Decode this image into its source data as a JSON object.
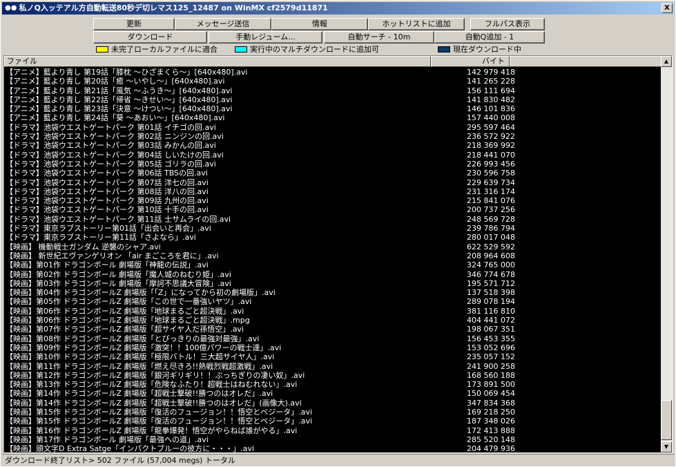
{
  "window": {
    "title": "私ノQ入ッテアル方自動転送80秒デ切レマス125_12487 on WinMX cf2579d11871",
    "close": "X"
  },
  "toolbar": {
    "row1": [
      "更新",
      "メッセージ送信",
      "情報",
      "ホットリストに追加",
      "フルパス表示"
    ],
    "row2": [
      "ダウンロード",
      "手動レジューム...",
      "自動サーチ - 10m",
      "自動Q追加 - 1"
    ]
  },
  "legend": [
    {
      "label": "未完了ローカルファイルに適合",
      "color": "#ffff00"
    },
    {
      "label": "実行中のマルチダウンロードに追加可",
      "color": "#00ffff"
    },
    {
      "label": "現在ダウンロード中",
      "color": "#0a3a6a"
    }
  ],
  "columns": {
    "file": "ファイル",
    "bytes": "バイト"
  },
  "files": [
    [
      "【アニメ】藍より青し 第19話「膝枕 ～ひざまくら～」[640x480].avi",
      "142 979 418"
    ],
    [
      "【アニメ】藍より青し 第20話「癒 ～いやし～」[640x480].avi",
      "141 265 228"
    ],
    [
      "【アニメ】藍より青し 第21話「風気 ～ふうき～」[640x480].avi",
      "156 111 694"
    ],
    [
      "【アニメ】藍より青し 第22話「帰省 ～きせい～」[640x480].avi",
      "141 830 482"
    ],
    [
      "【アニメ】藍より青し 第23話「決意 ～けつい～」[640x480].avi",
      "146 101 836"
    ],
    [
      "【アニメ】藍より青し 第24話「葵 ～あおい～」[640x480].avi",
      "157 440 008"
    ],
    [
      "【ドラマ】池袋ウエストゲートパーク 第01話 イチゴの回.avi",
      "295 597 464"
    ],
    [
      "【ドラマ】池袋ウエストゲートパーク 第02話 ニンジンの回.avi",
      "236 572 922"
    ],
    [
      "【ドラマ】池袋ウエストゲートパーク 第03話 みかんの回.avi",
      "218 369 992"
    ],
    [
      "【ドラマ】池袋ウエストゲートパーク 第04話 しいたけの回.avi",
      "218 441 070"
    ],
    [
      "【ドラマ】池袋ウエストゲートパーク 第05話 ゴリラの回.avi",
      "226 993 456"
    ],
    [
      "【ドラマ】池袋ウエストゲートパーク 第06話 TBSの回.avi",
      "230 596 758"
    ],
    [
      "【ドラマ】池袋ウエストゲートパーク 第07話 洋七の回.avi",
      "229 639 734"
    ],
    [
      "【ドラマ】池袋ウエストゲートパーク 第08話 洋八の回.avi",
      "231 316 174"
    ],
    [
      "【ドラマ】池袋ウエストゲートパーク 第09話 九州の回.avi",
      "215 841 076"
    ],
    [
      "【ドラマ】池袋ウエストゲートパーク 第10話 十手の回.avi",
      "200 737 256"
    ],
    [
      "【ドラマ】池袋ウエストゲートパーク 第11話 士サムライの回.avi",
      "248 569 728"
    ],
    [
      "【ドラマ】東京ラブストーリー第01話「出会いと再会」.avi",
      "239 786 794"
    ],
    [
      "【ドラマ】東京ラブストーリー第11話「さよなら」.avi",
      "280 017 048"
    ],
    [
      "【映画】 機動戦士ガンダム 逆襲のシャア.avi",
      "622 529 592"
    ],
    [
      "【映画】 新世紀エヴァンゲリオン 「air まごころを君に」.avi",
      "208 964 608"
    ],
    [
      "【映画】第01作 ドラゴンボール 劇場版「神龍の伝説」.avi",
      "324 765 000"
    ],
    [
      "【映画】第02作 ドラゴンボール 劇場版「魔人城のねむり姫」.avi",
      "346 774 678"
    ],
    [
      "【映画】第03作 ドラゴンボール 劇場版「摩訶不思議大冒険」.avi",
      "195 571 712"
    ],
    [
      "【映画】第04作 ドラゴンボールZ 劇場版「「Z」になってから初の劇場版」.avi",
      "137 518 398"
    ],
    [
      "【映画】第05作 ドラゴンボールZ 劇場版「この世で一番強いヤツ」.avi",
      "289 078 194"
    ],
    [
      "【映画】第06作 ドラゴンボールZ 劇場版「地球まるごと超決戦」.avi",
      "381 116 810"
    ],
    [
      "【映画】第06作 ドラゴンボールZ 劇場版「地球まるごと超決戦」.mpg",
      "404 441 072"
    ],
    [
      "【映画】第07作 ドラゴンボールZ 劇場版「超サイヤ人だ孫悟空」.avi",
      "198 067 351"
    ],
    [
      "【映画】第08作 ドラゴンボールZ 劇場版「とびっきりの最強対最強」.avi",
      "156 453 355"
    ],
    [
      "【映画】第09作 ドラゴンボールZ 劇場版「激突！！100億パワーの戦士達」.avi",
      "153 052 696"
    ],
    [
      "【映画】第10作 ドラゴンボールZ 劇場版「極限バトル！三大超サイヤ人」.avi",
      "235 057 152"
    ],
    [
      "【映画】第11作 ドラゴンボールZ 劇場版「燃え尽きろ!!熱戦烈戦超激戦」.avi",
      "241 900 258"
    ],
    [
      "【映画】第12作 ドラゴンボールZ 劇場版「銀河ギリギリ！！ぶっちぎりの凄い奴」.avi",
      "168 560 188"
    ],
    [
      "【映画】第13作 ドラゴンボールZ 劇場版「危険なふたり！超戦士はねむれない」.avi",
      "173 891 500"
    ],
    [
      "【映画】第14作 ドラゴンボールZ 劇場版「超戦士撃破!!勝つのはオレだ」.avi",
      "150 069 454"
    ],
    [
      "【映画】第14作 ドラゴンボールZ 劇場版「超戦士撃破!!勝つのはオレだ」(画像大).avi",
      "347 834 368"
    ],
    [
      "【映画】第15作 ドラゴンボールZ 劇場版「復活のフュージョン！！悟空とベジータ」.avi",
      "169 218 250"
    ],
    [
      "【映画】第15作 ドラゴンボールZ 劇場版「復活のフュージョン！！悟空とベジータ」.avi",
      "187 348 026"
    ],
    [
      "【映画】第16作 ドラゴンボールZ 劇場版「龍拳爆発！悟空がやらねば誰がやる」.avi",
      "172 413 888"
    ],
    [
      "【映画】第17作 ドラゴンボール 劇場版「最強への道」.avi",
      "285 520 148"
    ],
    [
      "【映画】頭文字D  Extra Satge「インパクトブルーの彼方に・・・」.avi",
      "204 479 936"
    ]
  ],
  "status": "ダウンロード終了リスト> 502 ファイル (57,004 megs) トータル"
}
